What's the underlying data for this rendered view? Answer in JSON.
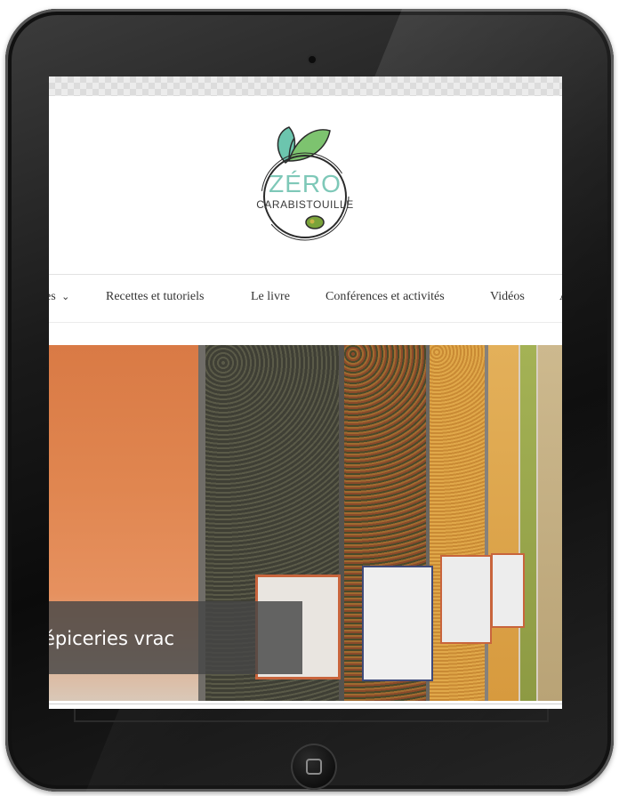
{
  "site": {
    "logo_title": "ZÉRO",
    "logo_subtitle": "CARABISTOUILLE"
  },
  "nav": {
    "items": [
      {
        "label": "es",
        "has_dropdown": true
      },
      {
        "label": "Recettes et tutoriels"
      },
      {
        "label": "Le livre"
      },
      {
        "label": "Conférences et activités"
      },
      {
        "label": "Vidéos"
      },
      {
        "label": "A"
      }
    ],
    "dropdown_glyph": "⌄"
  },
  "hero": {
    "caption": "épiceries vrac"
  },
  "icons": {
    "camera": "camera-icon",
    "home": "home-button-icon",
    "dropdown": "chevron-down-icon"
  },
  "colors": {
    "logo_green": "#7ec8b8",
    "leaf_green": "#5fbf8a",
    "olive": "#7aa33a"
  }
}
